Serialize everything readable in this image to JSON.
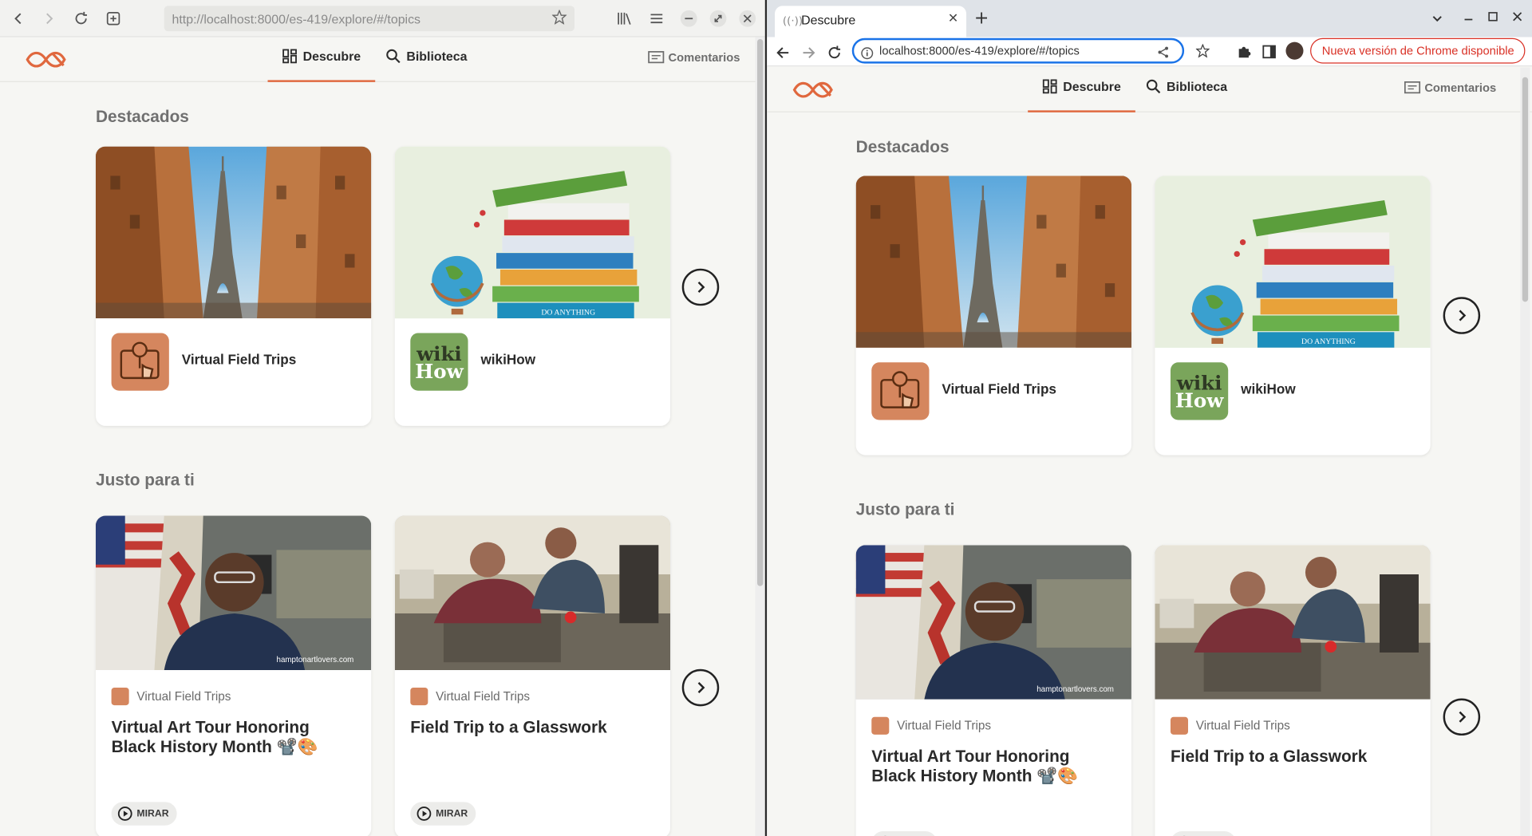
{
  "firefox": {
    "url": "http://localhost:8000/es-419/explore/#/topics"
  },
  "chrome": {
    "tab_title": "Descubre",
    "url": "localhost:8000/es-419/explore/#/topics",
    "update_button": "Nueva versión de Chrome disponible"
  },
  "app": {
    "nav": {
      "discover": "Descubre",
      "library": "Biblioteca",
      "comments": "Comentarios"
    },
    "featured_title": "Destacados",
    "featured": [
      {
        "name": "Virtual Field Trips",
        "icon": "map-pin-touch-icon",
        "color": "#d5865e"
      },
      {
        "name": "wikiHow",
        "icon": "wikihow-logo",
        "color": "#7aa55b",
        "logo_text_1": "wiki",
        "logo_text_2": "How"
      }
    ],
    "for_you_title": "Justo para ti",
    "for_you": [
      {
        "source": "Virtual Field Trips",
        "title": "Virtual Art Tour Honoring Black History Month 📽️🎨",
        "action": "MIRAR",
        "watermark": "hamptonartlovers.com"
      },
      {
        "source": "Virtual Field Trips",
        "title": "Field Trip to a Glasswork",
        "action": "MIRAR"
      }
    ]
  },
  "colors": {
    "accent": "#e0683e",
    "vft_orange": "#d5865e",
    "wikihow_green": "#7aa55b",
    "chrome_blue": "#1a73e8",
    "chrome_red": "#d93025"
  }
}
